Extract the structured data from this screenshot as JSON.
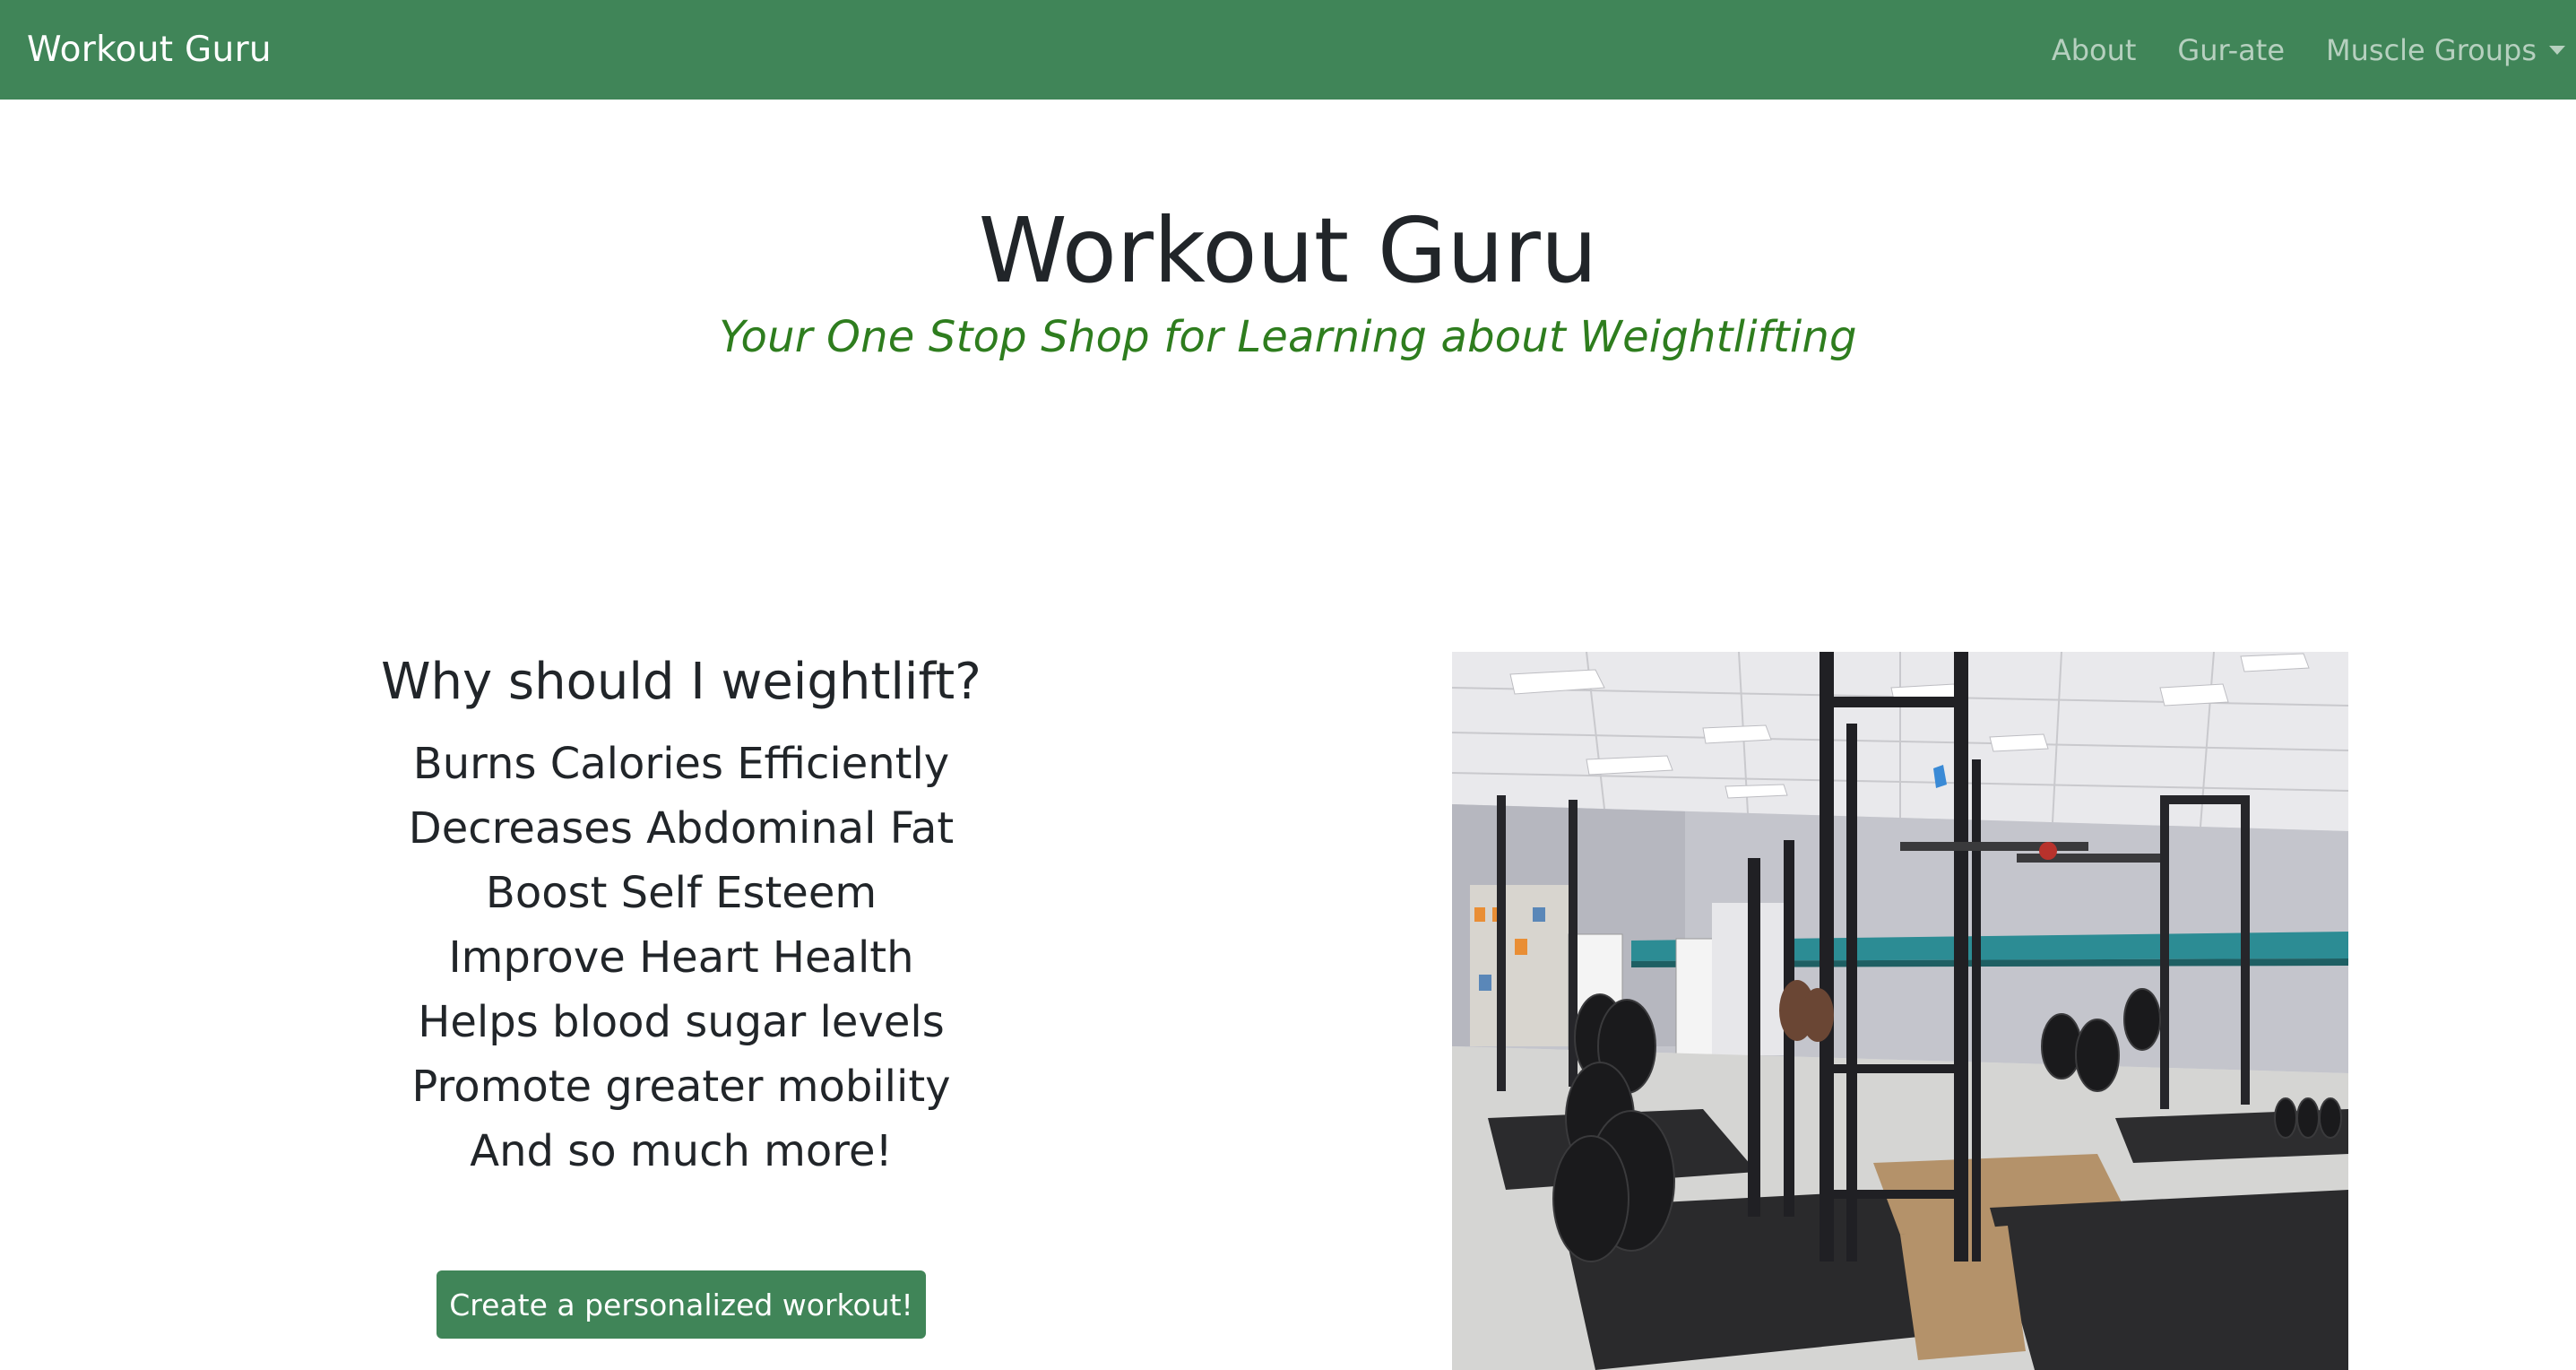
{
  "navbar": {
    "brand": "Workout Guru",
    "links": [
      {
        "label": "About"
      },
      {
        "label": "Gur-ate"
      },
      {
        "label": "Muscle Groups"
      }
    ]
  },
  "hero": {
    "title": "Workout Guru",
    "subtitle": "Your One Stop Shop for Learning about Weightlifting"
  },
  "why": {
    "heading": "Why should I weightlift?",
    "benefits": [
      "Burns Calories Efficiently",
      "Decreases Abdominal Fat",
      "Boost Self Esteem",
      "Improve Heart Health",
      "Helps blood sugar levels",
      "Promote greater mobility",
      "And so much more!"
    ],
    "cta_label": "Create a personalized workout!"
  },
  "colors": {
    "brand_green": "#408558",
    "subtitle_green": "#2e7d1e"
  },
  "image": {
    "semantic": "gym-photo"
  }
}
